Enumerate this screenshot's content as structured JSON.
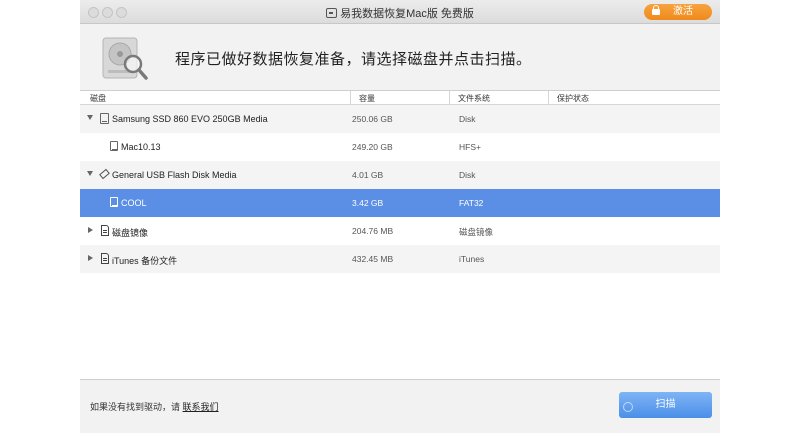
{
  "window": {
    "title": "易我数据恢复Mac版 免费版",
    "activate_label": "激活"
  },
  "header": {
    "prompt": "程序已做好数据恢复准备，请选择磁盘并点击扫描。"
  },
  "table": {
    "columns": [
      "磁盘",
      "容量",
      "文件系统",
      "保护状态"
    ],
    "rows": [
      {
        "name": "Samsung SSD 860 EVO 250GB Media",
        "size": "250.06 GB",
        "fs": "Disk",
        "level": 0,
        "expander": "expanded",
        "icon": "drive-icon"
      },
      {
        "name": "Mac10.13",
        "size": "249.20 GB",
        "fs": "HFS+",
        "level": 1,
        "expander": "none",
        "icon": "volume-icon"
      },
      {
        "name": "General USB Flash Disk Media",
        "size": "4.01 GB",
        "fs": "Disk",
        "level": 0,
        "expander": "expanded",
        "icon": "usb-icon"
      },
      {
        "name": "COOL",
        "size": "3.42 GB",
        "fs": "FAT32",
        "level": 1,
        "expander": "none",
        "icon": "volume-icon",
        "selected": true
      },
      {
        "name": "磁盘镜像",
        "size": "204.76 MB",
        "fs": "磁盘镜像",
        "level": 0,
        "expander": "collapsed",
        "icon": "file-icon"
      },
      {
        "name": "iTunes 备份文件",
        "size": "432.45 MB",
        "fs": "iTunes",
        "level": 0,
        "expander": "collapsed",
        "icon": "file-icon"
      }
    ]
  },
  "footer": {
    "note": "如果没有找到驱动，请",
    "link": "联系我们",
    "scan_label": "扫描"
  },
  "colors": {
    "accent_orange": "#ef8a1c",
    "selection_blue": "#5b8fe6",
    "scan_blue": "#4a8fe8"
  }
}
